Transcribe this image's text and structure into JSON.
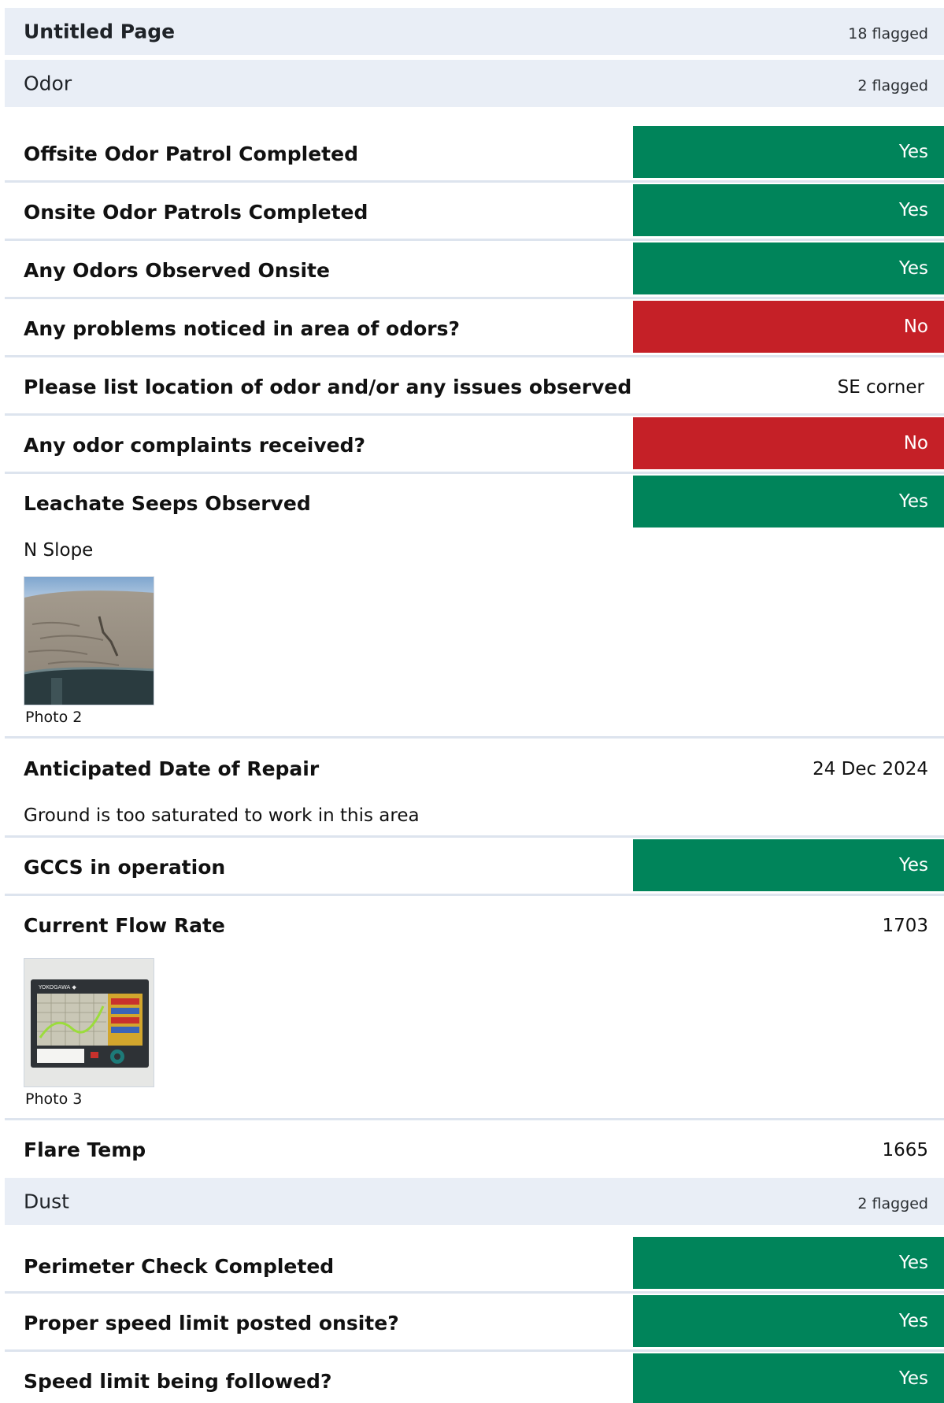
{
  "page": {
    "title": "Untitled Page",
    "flagged": "18 flagged"
  },
  "sections": [
    {
      "title": "Odor",
      "flagged": "2 flagged"
    },
    {
      "title": "Dust",
      "flagged": "2 flagged"
    }
  ],
  "odor": {
    "items": [
      {
        "label": "Offsite Odor Patrol Completed",
        "answer": "Yes"
      },
      {
        "label": "Onsite Odor Patrols Completed",
        "answer": "Yes"
      },
      {
        "label": "Any Odors Observed Onsite",
        "answer": "Yes"
      },
      {
        "label": "Any problems noticed in area of odors?",
        "answer": "No"
      },
      {
        "label": "Please list location of odor and/or any issues observed",
        "answer": "SE corner"
      },
      {
        "label": "Any odor complaints received?",
        "answer": "No"
      },
      {
        "label": "Leachate Seeps Observed",
        "answer": "Yes",
        "note": "N Slope",
        "photo_caption": "Photo 2"
      },
      {
        "label": "Anticipated Date of Repair",
        "answer": "24 Dec 2024",
        "note": "Ground is too saturated to work in this area"
      },
      {
        "label": "GCCS in operation",
        "answer": "Yes"
      },
      {
        "label": "Current Flow Rate",
        "answer": "1703",
        "photo_caption": "Photo 3"
      },
      {
        "label": "Flare Temp",
        "answer": "1665"
      }
    ]
  },
  "dust": {
    "items": [
      {
        "label": "Perimeter Check Completed",
        "answer": "Yes"
      },
      {
        "label": "Proper speed limit posted onsite?",
        "answer": "Yes"
      },
      {
        "label": "Speed limit being followed?",
        "answer": "Yes"
      }
    ]
  },
  "colors": {
    "yes": "#00845a",
    "no": "#c52027",
    "header_bg": "#e9eef6",
    "separator": "#dde4ee"
  },
  "photo_overlay": {
    "brand": "YOKOGAWA ◆"
  }
}
